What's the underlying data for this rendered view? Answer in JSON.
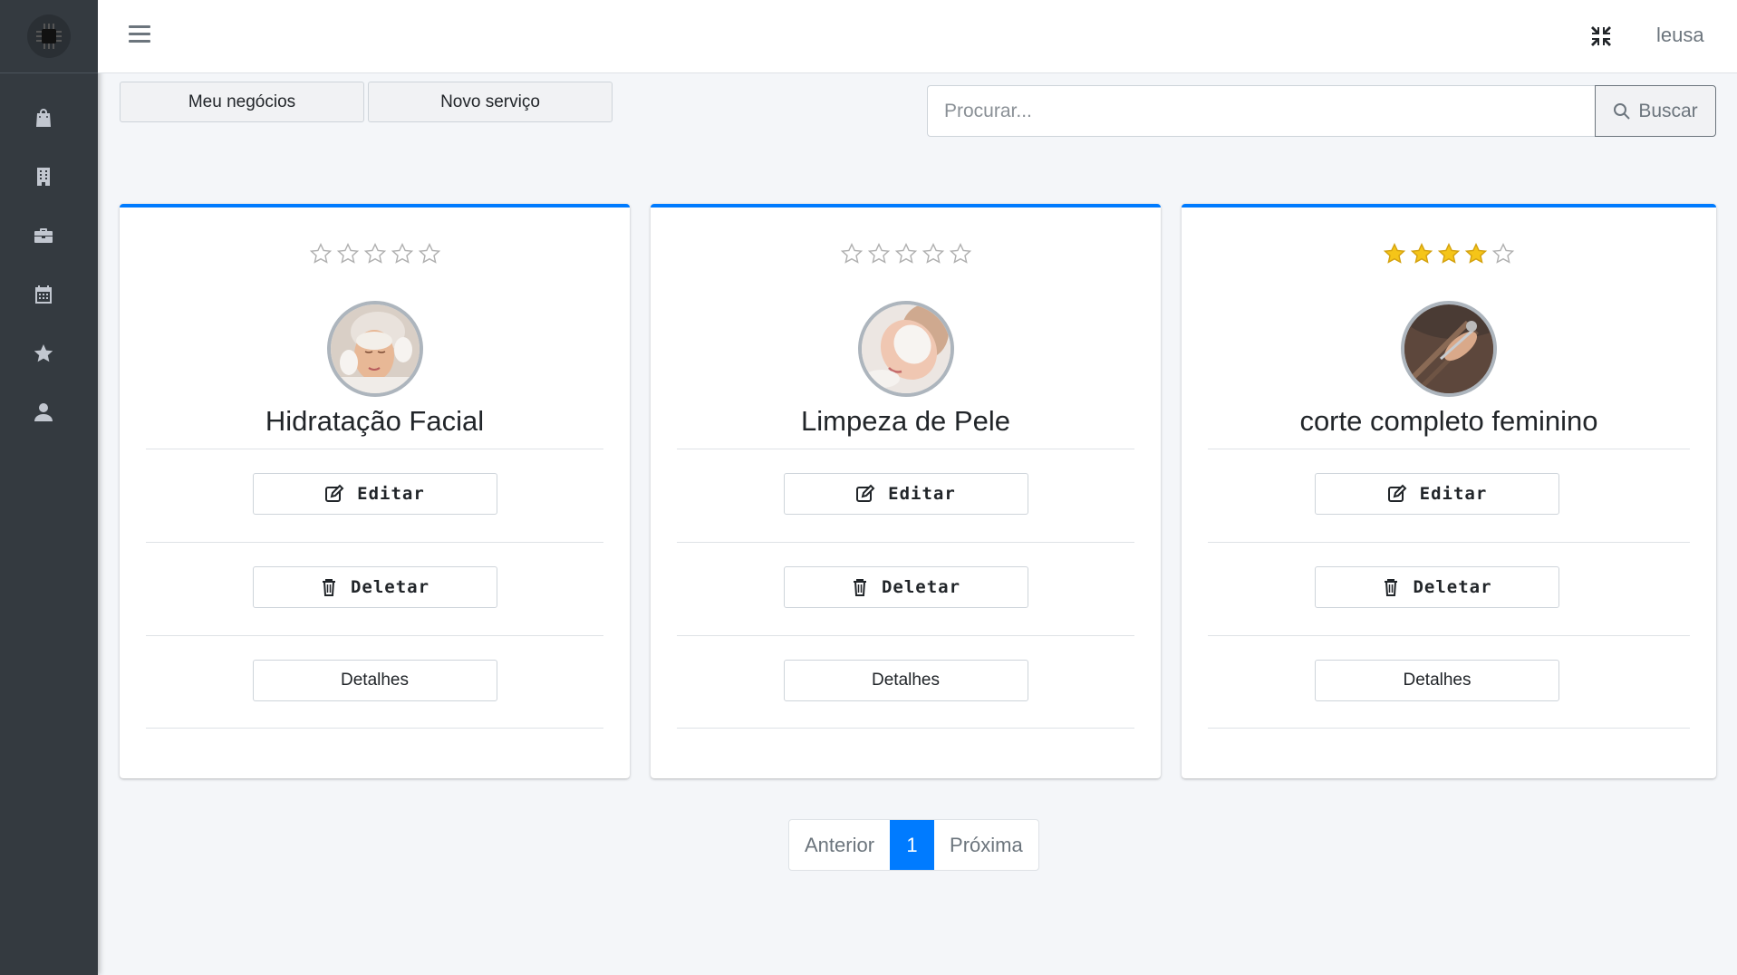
{
  "topbar": {
    "user": "leusa"
  },
  "sidebar": {
    "items": [
      {
        "icon": "shopping-bag-icon"
      },
      {
        "icon": "building-icon"
      },
      {
        "icon": "briefcase-icon"
      },
      {
        "icon": "calendar-icon"
      },
      {
        "icon": "star-icon"
      },
      {
        "icon": "user-icon"
      }
    ]
  },
  "toolbar": {
    "my_business_label": "Meu negócios",
    "new_service_label": "Novo serviço",
    "search_placeholder": "Procurar...",
    "search_label": "Buscar"
  },
  "services": [
    {
      "title": "Hidratação Facial",
      "rating": 0,
      "max_rating": 5,
      "edit_label": "Editar",
      "delete_label": "Deletar",
      "details_label": "Detalhes"
    },
    {
      "title": "Limpeza de Pele",
      "rating": 0,
      "max_rating": 5,
      "edit_label": "Editar",
      "delete_label": "Deletar",
      "details_label": "Detalhes"
    },
    {
      "title": "corte completo feminino",
      "rating": 4,
      "max_rating": 5,
      "edit_label": "Editar",
      "delete_label": "Deletar",
      "details_label": "Detalhes"
    }
  ],
  "pagination": {
    "prev_label": "Anterior",
    "current": "1",
    "next_label": "Próxima"
  },
  "colors": {
    "accent": "#007bff",
    "sidebar": "#343a40",
    "star_filled": "#f5c518",
    "star_empty": "#b0b0b0"
  }
}
